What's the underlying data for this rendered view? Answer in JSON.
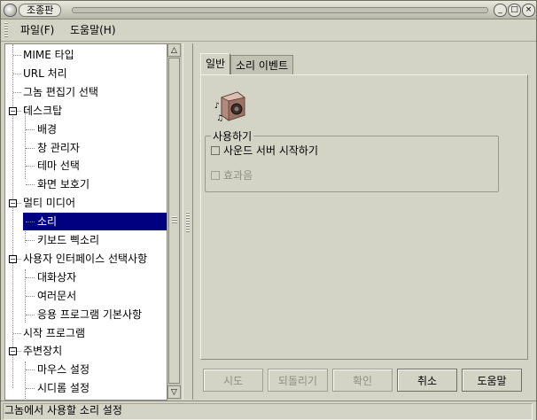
{
  "window": {
    "title": "조종판",
    "buttons": {
      "minimize": "_",
      "maximize": "□",
      "close": "×"
    }
  },
  "menubar": {
    "file": "파일(F)",
    "help": "도움말(H)"
  },
  "tree": {
    "items": [
      {
        "label": "MIME 타입",
        "level": 1,
        "selected": false
      },
      {
        "label": "URL 처리",
        "level": 1,
        "selected": false
      },
      {
        "label": "그놈 편집기 선택",
        "level": 1,
        "selected": false
      },
      {
        "label": "데스크탑",
        "level": 0,
        "expander": "minus",
        "selected": false
      },
      {
        "label": "배경",
        "level": 2,
        "selected": false
      },
      {
        "label": "창 관리자",
        "level": 2,
        "selected": false
      },
      {
        "label": "테마 선택",
        "level": 2,
        "selected": false
      },
      {
        "label": "화면 보호기",
        "level": 2,
        "selected": false
      },
      {
        "label": "멀티 미디어",
        "level": 0,
        "expander": "minus",
        "selected": false
      },
      {
        "label": "소리",
        "level": 2,
        "selected": true
      },
      {
        "label": "키보드 삑소리",
        "level": 2,
        "selected": false
      },
      {
        "label": "사용자 인터페이스 선택사항",
        "level": 0,
        "expander": "minus",
        "selected": false
      },
      {
        "label": "대화상자",
        "level": 2,
        "selected": false
      },
      {
        "label": "여러문서",
        "level": 2,
        "selected": false
      },
      {
        "label": "응용 프로그램 기본사항",
        "level": 2,
        "selected": false
      },
      {
        "label": "시작 프로그램",
        "level": 1,
        "selected": false
      },
      {
        "label": "주변장치",
        "level": 0,
        "expander": "minus",
        "selected": false
      },
      {
        "label": "마우스 설정",
        "level": 2,
        "selected": false
      },
      {
        "label": "시디롬 설정",
        "level": 2,
        "selected": false
      }
    ],
    "scroll": {
      "up": "△",
      "down": "▽"
    }
  },
  "tabs": [
    {
      "label": "일반",
      "active": true
    },
    {
      "label": "소리 이벤트",
      "active": false
    }
  ],
  "general": {
    "icon": "speaker-icon",
    "group_title": "사용하기",
    "start_sound_server": {
      "label": "사운드 서버 시작하기",
      "checked": false,
      "enabled": true
    },
    "sound_effects": {
      "label": "효과음",
      "checked": false,
      "enabled": false
    }
  },
  "buttons": {
    "try": "시도",
    "revert": "되돌리기",
    "ok": "확인",
    "cancel": "취소",
    "help": "도움말"
  },
  "statusbar": {
    "text": "그놈에서 사용할 소리 설정"
  },
  "colors": {
    "selection": "#000080",
    "window_bg": "#d4d4c6"
  }
}
